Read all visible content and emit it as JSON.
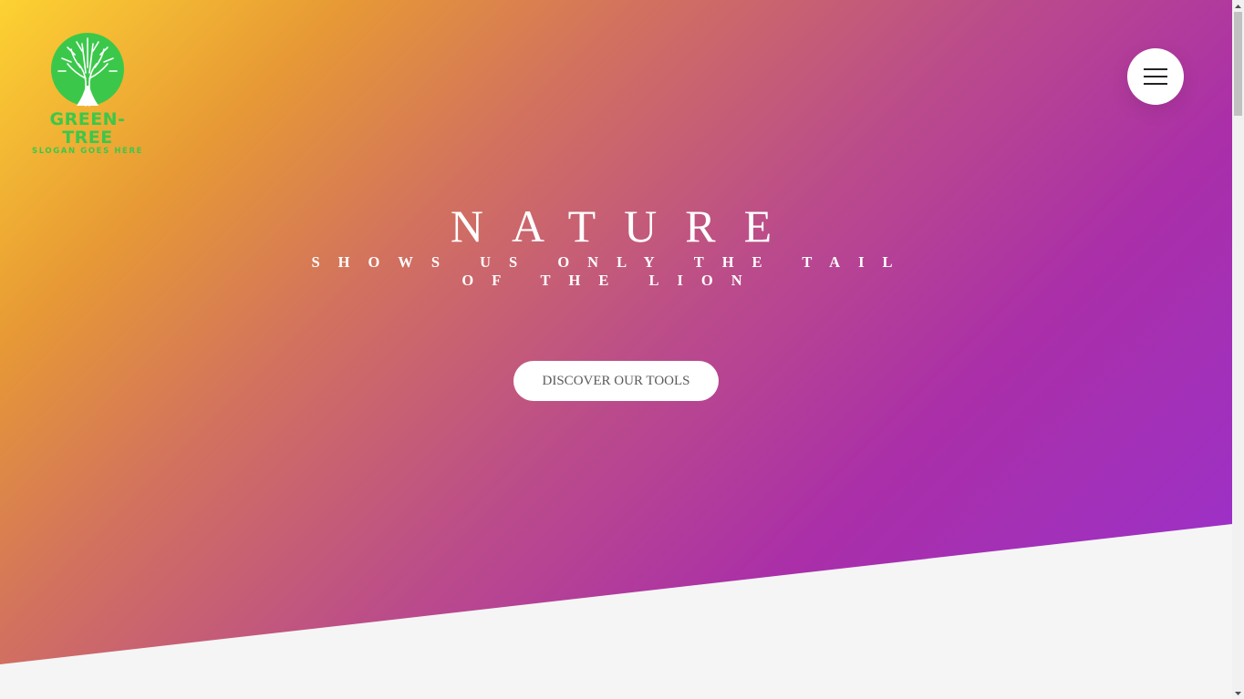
{
  "brand": {
    "name": "GREEN-TREE",
    "slogan": "SLOGAN GOES HERE",
    "logo_icon": "tree-icon",
    "color": "#3bc84a"
  },
  "menu": {
    "icon": "hamburger-menu-icon"
  },
  "hero": {
    "title": "NATURE",
    "subtitle": "SHOWS US ONLY THE TAIL OF THE LION",
    "cta_label": "DISCOVER OUR TOOLS",
    "gradient_colors": [
      "#fdd232",
      "#e79935",
      "#bb4c8a",
      "#aa2fa8",
      "#9a2fdf"
    ]
  },
  "scrollbar": {
    "up_icon": "scroll-up-arrow-icon",
    "down_icon": "scroll-down-arrow-icon"
  }
}
